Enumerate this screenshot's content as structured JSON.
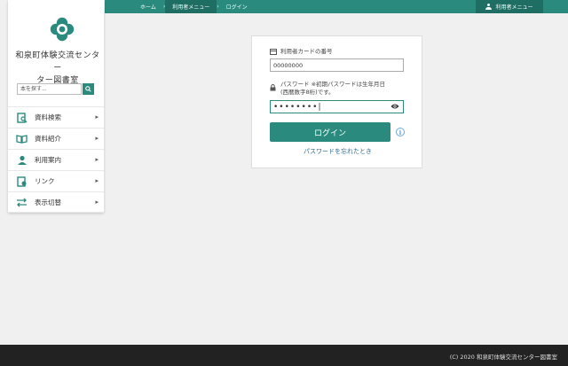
{
  "header": {
    "breadcrumbs": [
      "ホーム",
      "利用者メニュー",
      "ログイン"
    ],
    "menu_label": "利用者メニュー"
  },
  "sidebar": {
    "site_title_line1": "和泉町体験交流センター",
    "site_title_line2": "ター図書室",
    "search_placeholder": "本を探す...",
    "nav": [
      {
        "label": "資料検索"
      },
      {
        "label": "資料紹介"
      },
      {
        "label": "利用案内"
      },
      {
        "label": "リンク"
      },
      {
        "label": "表示切替"
      }
    ]
  },
  "login": {
    "card_label": "利用者カードの番号",
    "card_value": "00000000",
    "password_label_line1": "パスワード ※初期パスワードは生年月日",
    "password_label_line2": "(西暦数字8桁)です。",
    "password_value": "••••••••|",
    "login_button": "ログイン",
    "forgot_link": "パスワードを忘れたとき"
  },
  "footer": {
    "copyright": "(C) 2020 和泉町体験交流センター図書室"
  },
  "colors": {
    "brand": "#2a8a7d",
    "brand_dark": "#1f6e63",
    "footer": "#222222"
  }
}
